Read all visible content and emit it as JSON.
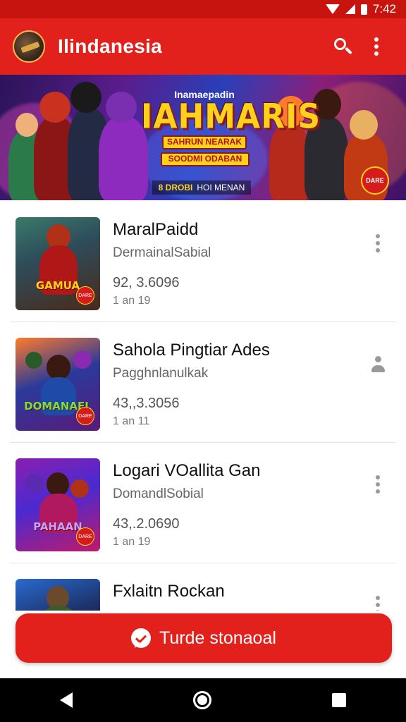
{
  "status_bar": {
    "time": "7:42"
  },
  "app_bar": {
    "title": "Ilindanesia",
    "search_icon": "search-icon",
    "menu_icon": "more-vert-icon"
  },
  "banner": {
    "top_text": "Inamaepadin",
    "title": "IAHMARIS",
    "subtitle_1": "SAHRUN NEARAK",
    "subtitle_2": "SOODMI ODABAN",
    "footer_left": "8 DROBI",
    "footer_right": "HOI MENAN",
    "badge": "DARE"
  },
  "items": [
    {
      "title": "MaralPaidd",
      "subtitle": "DermainalSabial",
      "count": "92, 3.6096",
      "meta": "1 an 19",
      "thumb_label": "GAMUA",
      "thumb_badge": "DARE",
      "menu_icon": "more-vert-icon"
    },
    {
      "title": "Sahola Pingtiar Ades",
      "subtitle": "Pagghnlanulkak",
      "count": "43,,3.3056",
      "meta": "1 an 11",
      "thumb_label": "DOMANAEL",
      "thumb_badge": "DARE",
      "menu_icon": "person-icon"
    },
    {
      "title": "Logari VOallita Gan",
      "subtitle": "DomandlSobial",
      "count": "43,.2.0690",
      "meta": "1 an 19",
      "thumb_label": "PAHAAN",
      "thumb_badge": "DARE",
      "menu_icon": "more-vert-icon"
    },
    {
      "title": "Fxlaitn Rockan",
      "subtitle": "",
      "count": "",
      "meta": "",
      "thumb_label": "",
      "thumb_badge": "",
      "menu_icon": "more-vert-icon"
    }
  ],
  "cta": {
    "label": "Turde stonaoal",
    "icon": "chat-icon"
  },
  "nav": {
    "back": "back-icon",
    "home": "home-icon",
    "recents": "recents-icon"
  },
  "colors": {
    "primary": "#e3211c",
    "status_bar": "#c8140f",
    "text": "#111111",
    "secondary_text": "#666666"
  }
}
